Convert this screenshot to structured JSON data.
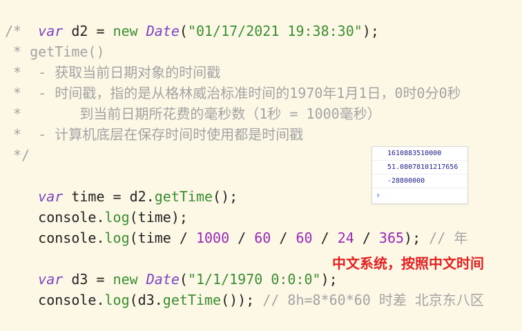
{
  "code": {
    "l1": [
      "var",
      " d2 = ",
      "new",
      " ",
      "Date",
      "(",
      "\"01/17/2021 19:38:30\"",
      ");"
    ],
    "l2": "/*",
    "l3": " * getTime()",
    "l4": " *  - 获取当前日期对象的时间戳",
    "l5": " *  - 时间戳，指的是从格林威治标准时间的1970年1月1日，0时0分0秒",
    "l6": " *       到当前日期所花费的毫秒数（1秒 = 1000毫秒）",
    "l7": " *  - 计算机底层在保存时间时使用都是时间戳",
    "l8": " */",
    "l9": [
      "var",
      " time = d2.",
      "getTime",
      "();"
    ],
    "l10": [
      "console.",
      "log",
      "(time);"
    ],
    "l11": [
      "console.",
      "log",
      "(time / ",
      "1000",
      " / ",
      "60",
      " / ",
      "60",
      " / ",
      "24",
      " / ",
      "365",
      "); ",
      "// 年"
    ],
    "l13": [
      "var",
      " d3 = ",
      "new",
      " ",
      "Date",
      "(",
      "\"1/1/1970 0:0:0\"",
      ");"
    ],
    "l14": [
      "console.",
      "log",
      "(d3.",
      "getTime",
      "()); ",
      "// 8h=8*60*60 时差 北京东八区"
    ]
  },
  "annotation": "中文系统，按照中文时间",
  "console": {
    "outputs": [
      "1610883510000",
      "51.08078101217656",
      "-28800000"
    ],
    "prompt_symbol": "›"
  },
  "colors": {
    "background": "#fdf8e6",
    "keyword": "#7b42c4",
    "function": "#3b8e30",
    "string": "#3b8e30",
    "number": "#9a28b8",
    "comment": "#a3a3a3",
    "annotation": "#e62020",
    "console_value": "#1c1c9e"
  }
}
